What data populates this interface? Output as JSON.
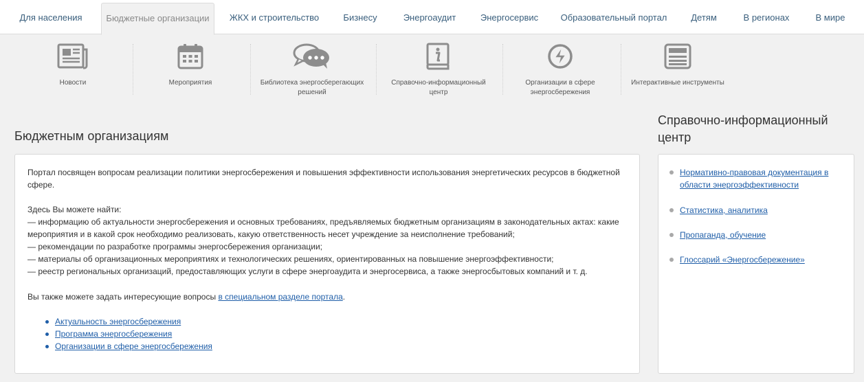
{
  "top_tabs": [
    {
      "label": "Для населения",
      "active": false
    },
    {
      "label": "Бюджетные организации",
      "active": true
    },
    {
      "label": "ЖКХ и строительство",
      "active": false
    },
    {
      "label": "Бизнесу",
      "active": false
    },
    {
      "label": "Энергоаудит",
      "active": false
    },
    {
      "label": "Энергосервис",
      "active": false
    },
    {
      "label": "Образовательный портал",
      "active": false
    },
    {
      "label": "Детям",
      "active": false
    },
    {
      "label": "В регионах",
      "active": false
    },
    {
      "label": "В мире",
      "active": false
    }
  ],
  "icon_nav": [
    {
      "label": "Новости",
      "icon": "newspaper-icon"
    },
    {
      "label": "Мероприятия",
      "icon": "calendar-icon"
    },
    {
      "label": "Библиотека энергосберегающих решений",
      "label_line1": "Библиотека энергосберегающих",
      "label_line2": "решений",
      "icon": "chat-bubbles-icon"
    },
    {
      "label": "Справочно-информационный центр",
      "label_line1": "Справочно-информационный",
      "label_line2": "центр",
      "icon": "info-book-icon"
    },
    {
      "label": "Организации в сфере энергосбережения",
      "label_line1": "Организации в сфере",
      "label_line2": "энергосбережения",
      "icon": "lightning-icon"
    },
    {
      "label": "Интерактивные инструменты",
      "icon": "calculator-icon"
    }
  ],
  "main": {
    "title": "Бюджетным организациям",
    "intro_line1": "Портал посвящен вопросам реализации политики энергосбережения и повышения эффективности использования энергетических ресурсов в бюджетной",
    "intro_line2": "сфере.",
    "find_heading": "Здесь Вы можете найти:",
    "find_items": [
      "— информацию об актуальности энергосбережения и основных требованиях, предъявляемых бюджетным организациям в законодательных актах: какие",
      "мероприятия и в какой срок необходимо реализовать, какую ответственность несет учреждение за неисполнение требований;",
      "— рекомендации по разработке программы энергосбережения организации;",
      "— материалы об организационных мероприятиях и технологических решениях, ориентированных на повышение энергоэффективности;",
      "— реестр региональных организаций, предоставляющих услуги в сфере энергоаудита и энергосервиса, а также энергосбытовых компаний и т. д."
    ],
    "question_text": "Вы также можете задать интересующие вопросы ",
    "question_link": "в специальном разделе портала",
    "question_end": ".",
    "links": [
      "Актуальность энергосбережения",
      "Программа энергосбережения",
      "Организации в сфере энергосбережения"
    ]
  },
  "sidebar": {
    "title_line1": "Справочно-информационный",
    "title_line2": "центр",
    "items": [
      {
        "line1": "Нормативно-правовая документация в",
        "line2": "области энергоэффективности"
      },
      {
        "line1": "Статистика, аналитика",
        "line2": ""
      },
      {
        "line1": "Пропаганда, обучение",
        "line2": ""
      },
      {
        "line1": "Глоссарий «Энергосбережение»",
        "line2": ""
      }
    ]
  },
  "colors": {
    "link": "#1f5ea8",
    "tab_link": "#3a5f7d",
    "icon_gray": "#8d8d8d",
    "background": "#f1f1f1"
  }
}
